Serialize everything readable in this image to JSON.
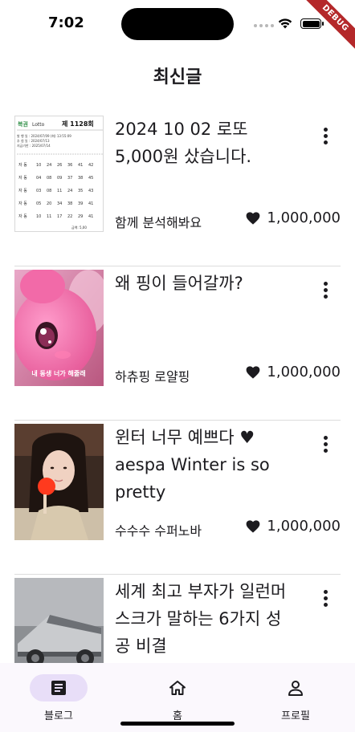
{
  "status_bar": {
    "time": "7:02"
  },
  "debug_banner": "DEBUG",
  "app_bar": {
    "title": "최신글"
  },
  "posts": [
    {
      "title": "2024 10 02 로또 5,000원 샀습니다.",
      "author": "함께 분석해봐요",
      "likes": "1,000,000"
    },
    {
      "title": "왜 핑이 들어갈까?",
      "author": "하츄핑 로얄핑",
      "likes": "1,000,000"
    },
    {
      "title": "윈터 너무 예쁘다 ♥ aespa Winter is so pretty",
      "author": "수수수 수퍼노바",
      "likes": "1,000,000"
    },
    {
      "title": "세계 최고 부자가 일런머스크가 말하는 6가지 성공 비결",
      "author": "",
      "likes": ""
    }
  ],
  "thumbs": {
    "lotto": {
      "logo": "복권",
      "brand": "Lotto",
      "round": "제 1128회",
      "lines": [
        "발 행 일 : 2024/07/09 (화) 13:55:09",
        "추 첨 일 : 2024/07/13",
        "지급기한 : 2025/07/14"
      ],
      "rows": [
        [
          "자 동",
          "10",
          "24",
          "26",
          "36",
          "41",
          "42"
        ],
        [
          "자 동",
          "04",
          "08",
          "09",
          "37",
          "38",
          "45"
        ],
        [
          "자 동",
          "03",
          "08",
          "11",
          "24",
          "35",
          "43"
        ],
        [
          "자 동",
          "05",
          "20",
          "34",
          "38",
          "39",
          "41"
        ],
        [
          "자 동",
          "10",
          "11",
          "17",
          "22",
          "29",
          "41"
        ]
      ],
      "amount": "금액: 5,00"
    },
    "ping_caption": "내 동생 너가 해줄래"
  },
  "bottom_nav": {
    "items": [
      {
        "label": "블로그",
        "icon": "article-icon",
        "active": true
      },
      {
        "label": "홈",
        "icon": "home-icon",
        "active": false
      },
      {
        "label": "프로필",
        "icon": "person-icon",
        "active": false
      }
    ]
  },
  "colors": {
    "nav_indicator": "#e8def8",
    "nav_background": "#fbf8fd",
    "debug": "#b4282a",
    "divider": "#dcdcdc"
  }
}
